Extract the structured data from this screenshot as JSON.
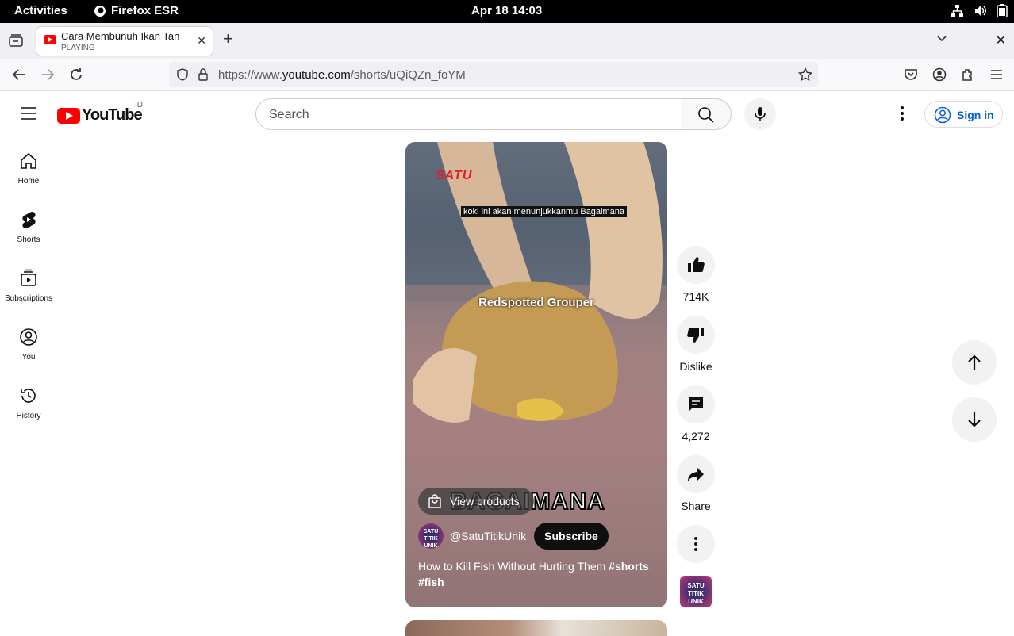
{
  "topbar": {
    "activities": "Activities",
    "app_name": "Firefox ESR",
    "clock": "Apr 18  14:03"
  },
  "browser": {
    "tab_title": "Cara Membunuh Ikan Tan",
    "tab_status": "PLAYING",
    "url_prefix": "https://www.",
    "url_domain": "youtube.com",
    "url_path": "/shorts/uQiQZn_foYM"
  },
  "youtube": {
    "logo_text": "YouTube",
    "country_code": "ID",
    "search_placeholder": "Search",
    "signin_label": "Sign in",
    "sidebar": [
      {
        "label": "Home",
        "icon": "home-icon"
      },
      {
        "label": "Shorts",
        "icon": "shorts-icon"
      },
      {
        "label": "Subscriptions",
        "icon": "subscriptions-icon"
      },
      {
        "label": "You",
        "icon": "you-icon"
      },
      {
        "label": "History",
        "icon": "history-icon"
      }
    ],
    "short": {
      "watermark": "SATU",
      "caption": "koki ini akan menunjukkanmu Bagaimana",
      "species_label": "Redspotted Grouper",
      "overlay_text": "BAGAIMANA",
      "view_products": "View products",
      "channel": "@SatuTitikUnik",
      "channel_avatar_text": "SATU TITIK UNIK",
      "subscribe": "Subscribe",
      "description": "How to Kill Fish Without Hurting Them",
      "hashtag1": "#shorts",
      "hashtag2": "#fish"
    },
    "actions": {
      "likes": "714K",
      "dislike": "Dislike",
      "comments": "4,272",
      "share": "Share"
    }
  },
  "colors": {
    "youtube_red": "#ff0000",
    "link_blue": "#065fd4"
  }
}
